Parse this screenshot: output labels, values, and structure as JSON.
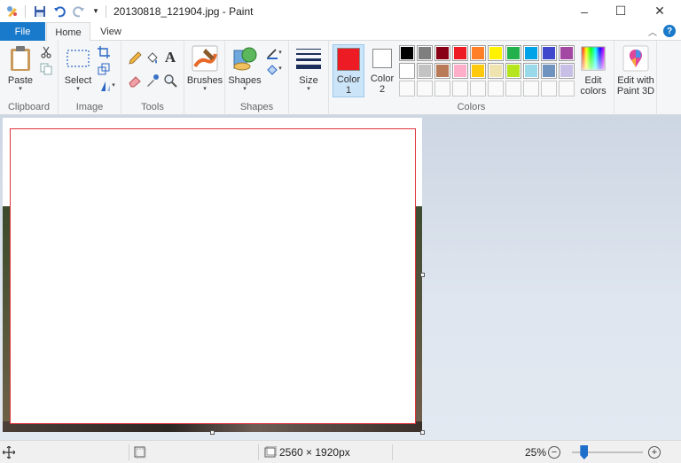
{
  "window": {
    "title": "20130818_121904.jpg - Paint",
    "minimize_glyph": "–",
    "maximize_glyph": "☐",
    "close_glyph": "✕"
  },
  "tabs": {
    "file": "File",
    "home": "Home",
    "view": "View",
    "help_glyph": "?",
    "collapse_glyph": "︿"
  },
  "ribbon": {
    "clipboard": {
      "paste": "Paste",
      "label": "Clipboard"
    },
    "image": {
      "select": "Select",
      "label": "Image"
    },
    "tools": {
      "label": "Tools",
      "text_glyph": "A"
    },
    "brushes": {
      "label": "Brushes"
    },
    "shapes": {
      "shapes": "Shapes",
      "label": "Shapes"
    },
    "size": {
      "label": "Size"
    },
    "colors": {
      "color1_line1": "Color",
      "color1_line2": "1",
      "color2_line1": "Color",
      "color2_line2": "2",
      "color1_value": "#ed1c24",
      "color2_value": "#ffffff",
      "edit_line1": "Edit",
      "edit_line2": "colors",
      "paint3d_line1": "Edit with",
      "paint3d_line2": "Paint 3D",
      "label": "Colors",
      "palette": [
        "#000000",
        "#7f7f7f",
        "#880015",
        "#ed1c24",
        "#ff7f27",
        "#fff200",
        "#22b14c",
        "#00a2e8",
        "#3f48cc",
        "#a349a4",
        "#ffffff",
        "#c3c3c3",
        "#b97a57",
        "#ffaec9",
        "#ffc90e",
        "#efe4b0",
        "#b5e61d",
        "#99d9ea",
        "#7092be",
        "#c8bfe7",
        "",
        "",
        "",
        "",
        "",
        "",
        "",
        "",
        "",
        ""
      ]
    },
    "caret": "▾"
  },
  "status": {
    "dimensions": "2560 × 1920px",
    "zoom": "25%",
    "zoom_level_percent": 25,
    "zoom_out_glyph": "−",
    "zoom_in_glyph": "+"
  }
}
